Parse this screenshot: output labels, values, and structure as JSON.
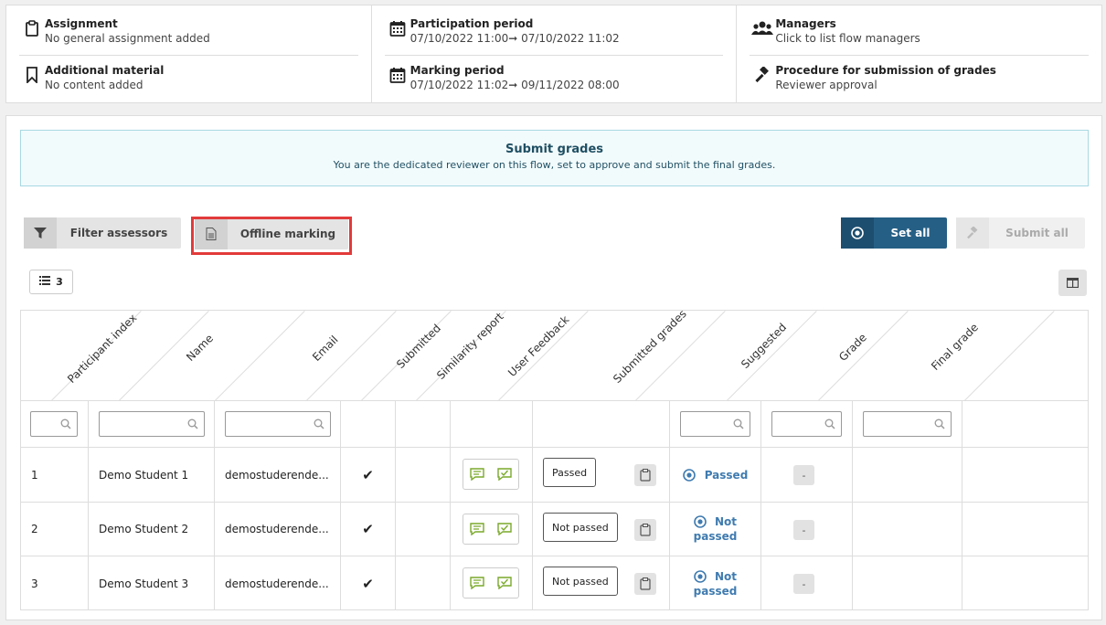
{
  "info": {
    "assignment": {
      "title": "Assignment",
      "sub": "No general assignment added"
    },
    "material": {
      "title": "Additional material",
      "sub": "No content added"
    },
    "participation": {
      "title": "Participation period",
      "sub": "07/10/2022 11:00➞ 07/10/2022 11:02"
    },
    "marking": {
      "title": "Marking period",
      "sub": "07/10/2022 11:02➞ 09/11/2022 08:00"
    },
    "managers": {
      "title": "Managers",
      "sub": "Click to list flow managers"
    },
    "procedure": {
      "title": "Procedure for submission of grades",
      "sub": "Reviewer approval"
    }
  },
  "banner": {
    "title": "Submit grades",
    "sub": "You are the dedicated reviewer on this flow, set to approve and submit the final grades."
  },
  "toolbar": {
    "filter_label": "Filter assessors",
    "offline_label": "Offline marking",
    "setall_label": "Set all",
    "submitall_label": "Submit all",
    "list_count": "3"
  },
  "table": {
    "headers": [
      "Participant index",
      "Name",
      "Email",
      "Submitted",
      "Similarity report",
      "User Feedback",
      "Submitted grades",
      "Suggested",
      "Grade",
      "Final grade"
    ],
    "rows": [
      {
        "index": "1",
        "name": "Demo Student 1",
        "email": "demostuderende...",
        "submitted_grade": "Passed",
        "suggested_1": "Passed",
        "suggested_2": "",
        "grade": "-"
      },
      {
        "index": "2",
        "name": "Demo Student 2",
        "email": "demostuderende...",
        "submitted_grade": "Not passed",
        "suggested_1": "Not",
        "suggested_2": "passed",
        "grade": "-"
      },
      {
        "index": "3",
        "name": "Demo Student 3",
        "email": "demostuderende...",
        "submitted_grade": "Not passed",
        "suggested_1": "Not",
        "suggested_2": "passed",
        "grade": "-"
      }
    ]
  },
  "colors": {
    "accent": "#265f85",
    "suggested": "#3f7bb0",
    "feedback": "#7aa92a",
    "highlight": "#e23a3a"
  }
}
